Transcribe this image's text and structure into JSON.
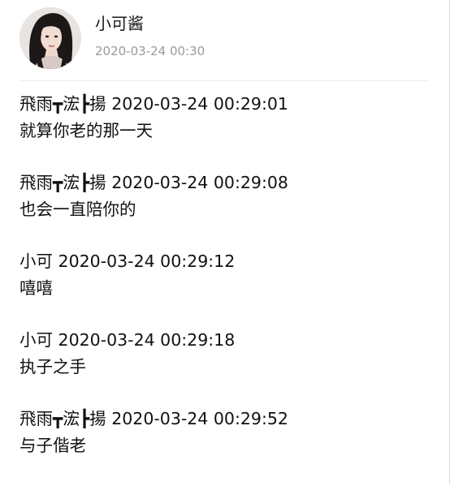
{
  "header": {
    "name": "小可酱",
    "time": "2020-03-24 00:30"
  },
  "messages": [
    {
      "sender": "飛雨┳浤┣揚",
      "time": "2020-03-24 00:29:01",
      "text": "就算你老的那一天"
    },
    {
      "sender": "飛雨┳浤┣揚",
      "time": "2020-03-24 00:29:08",
      "text": "也会一直陪你的"
    },
    {
      "sender": "小可",
      "time": "2020-03-24 00:29:12",
      "text": "嘻嘻"
    },
    {
      "sender": "小可",
      "time": "2020-03-24 00:29:18",
      "text": "执子之手"
    },
    {
      "sender": "飛雨┳浤┣揚",
      "time": "2020-03-24 00:29:52",
      "text": "与子偕老"
    }
  ]
}
